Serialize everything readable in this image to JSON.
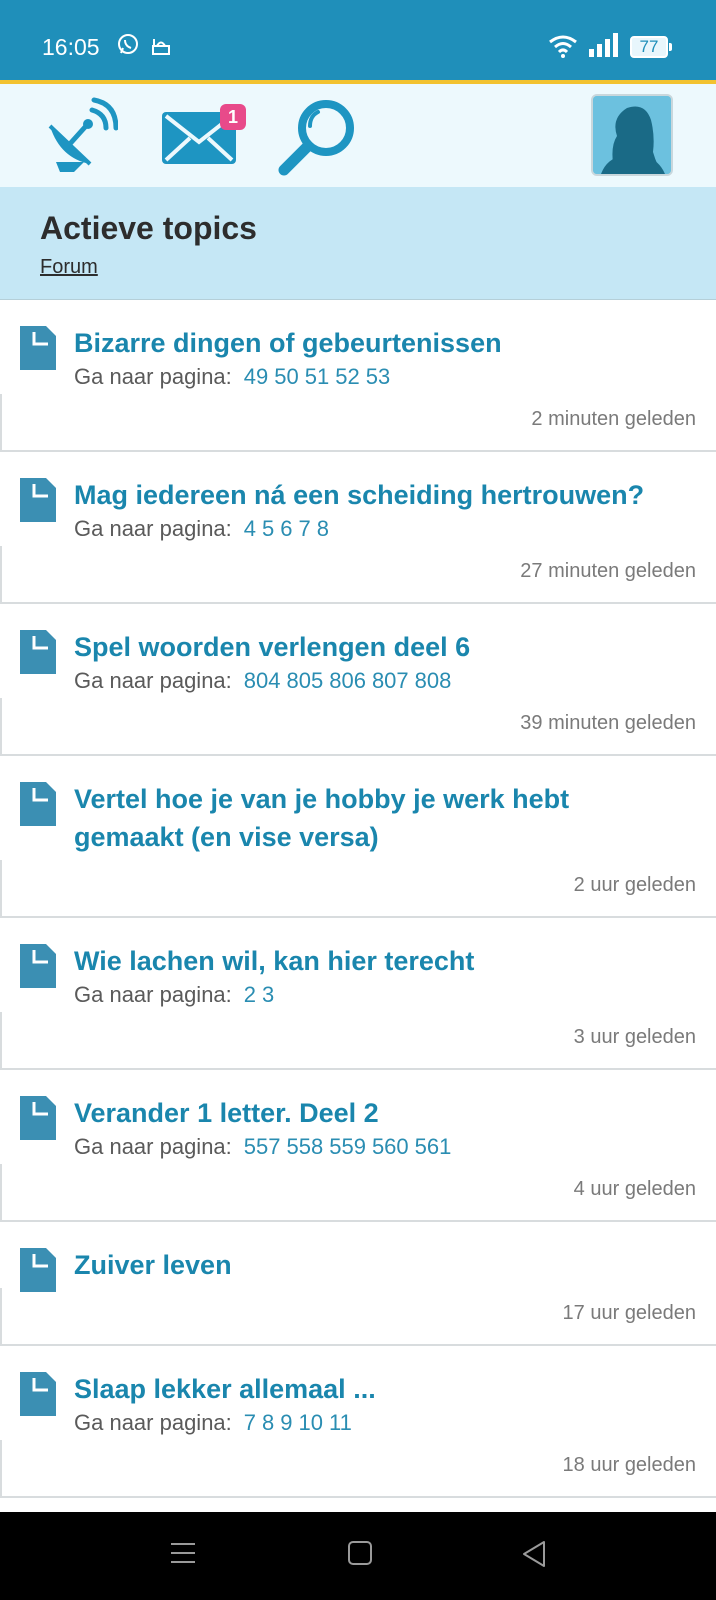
{
  "status": {
    "time": "16:05",
    "battery": "77"
  },
  "header": {
    "notification_badge": "1",
    "page_title": "Actieve topics",
    "breadcrumb": "Forum"
  },
  "labels": {
    "goto_page": "Ga naar pagina:"
  },
  "topics": [
    {
      "title": "Bizarre dingen of gebeurtenissen",
      "pages": [
        "49",
        "50",
        "51",
        "52",
        "53"
      ],
      "when": "2 minuten geleden"
    },
    {
      "title": "Mag iedereen ná een scheiding hertrouwen?",
      "pages": [
        "4",
        "5",
        "6",
        "7",
        "8"
      ],
      "when": "27 minuten geleden"
    },
    {
      "title": "Spel woorden verlengen deel 6",
      "pages": [
        "804",
        "805",
        "806",
        "807",
        "808"
      ],
      "when": "39 minuten geleden"
    },
    {
      "title": "Vertel hoe je van je hobby je werk hebt gemaakt (en vise versa)",
      "pages": [],
      "when": "2 uur geleden"
    },
    {
      "title": "Wie lachen wil, kan hier terecht",
      "pages": [
        "2",
        "3"
      ],
      "when": "3 uur geleden"
    },
    {
      "title": "Verander 1 letter. Deel 2",
      "pages": [
        "557",
        "558",
        "559",
        "560",
        "561"
      ],
      "when": "4 uur geleden"
    },
    {
      "title": "Zuiver leven",
      "pages": [],
      "when": "17 uur geleden"
    },
    {
      "title": "Slaap lekker allemaal ...",
      "pages": [
        "7",
        "8",
        "9",
        "10",
        "11"
      ],
      "when": "18 uur geleden"
    }
  ],
  "colors": {
    "status_bar": "#1f8fba",
    "toolbar_bg": "#edf9fd",
    "header_bg": "#c5e7f5",
    "link": "#1a86ad",
    "badge": "#e84a8a"
  },
  "icons": [
    "whatsapp-icon",
    "mosque-icon",
    "wifi-icon",
    "signal-icon",
    "battery-icon",
    "satellite-dish-icon",
    "mail-icon",
    "search-icon",
    "avatar",
    "document-icon",
    "menu-icon",
    "home-icon",
    "back-icon"
  ]
}
